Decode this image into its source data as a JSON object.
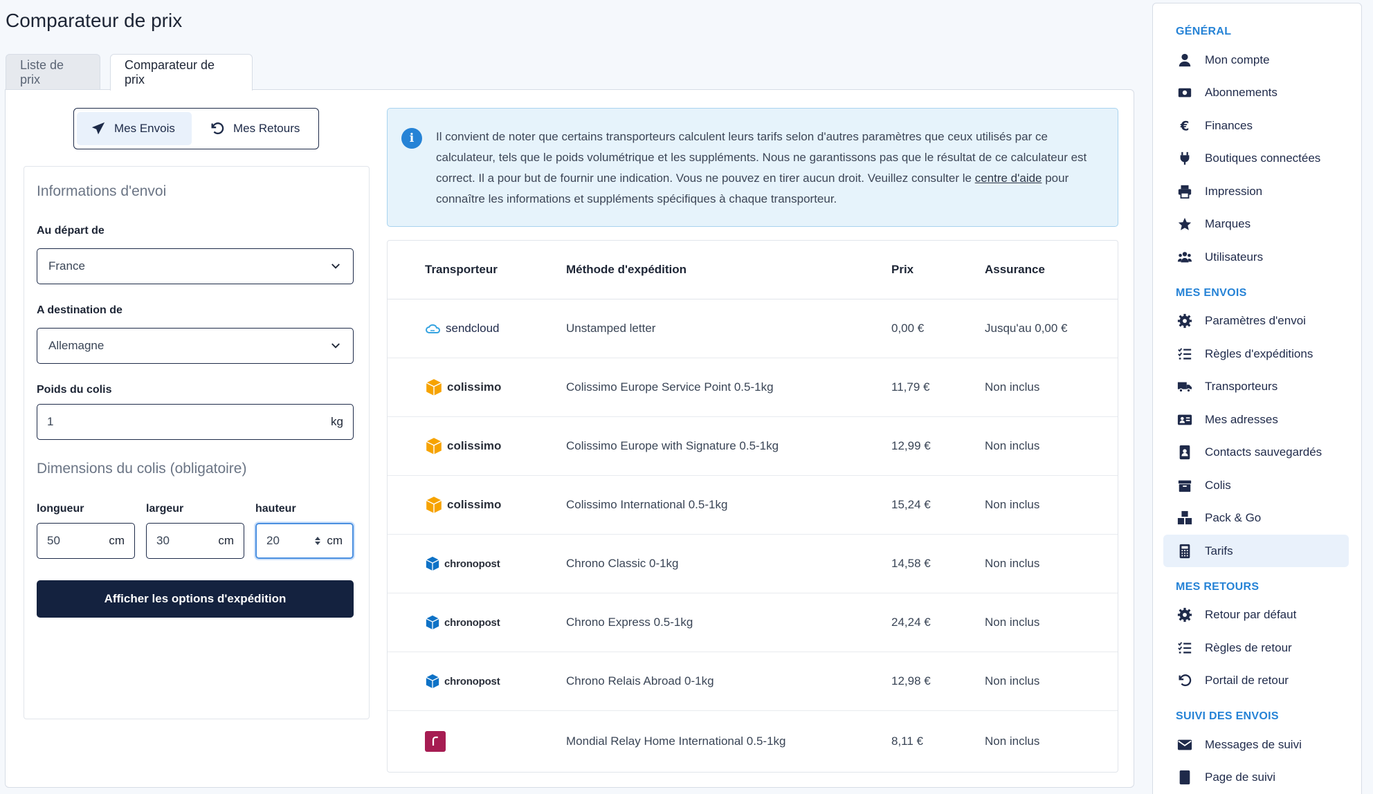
{
  "page": {
    "title": "Comparateur de prix"
  },
  "tabs": [
    {
      "label": "Liste de prix",
      "active": false
    },
    {
      "label": "Comparateur de prix",
      "active": true
    }
  ],
  "toggle": {
    "sends": "Mes Envois",
    "returns": "Mes Retours"
  },
  "form": {
    "section_shipping": "Informations d'envoi",
    "from_label": "Au départ de",
    "from_value": "France",
    "to_label": "A destination de",
    "to_value": "Allemagne",
    "weight_label": "Poids du colis",
    "weight_value": "1",
    "weight_unit": "kg",
    "section_dimensions": "Dimensions du colis (obligatoire)",
    "length_label": "longueur",
    "length_value": "50",
    "width_label": "largeur",
    "width_value": "30",
    "height_label": "hauteur",
    "height_value": "20",
    "dim_unit": "cm",
    "submit": "Afficher les options d'expédition"
  },
  "info": {
    "text_before": "Il convient de noter que certains transporteurs calculent leurs tarifs selon d'autres paramètres que ceux utilisés par ce calculateur, tels que le poids volumétrique et les suppléments. Nous ne garantissons pas que le résultat de ce calculateur est correct. Il a pour but de fournir une indication. Vous ne pouvez en tirer aucun droit. Veuillez consulter le ",
    "link": "centre d'aide",
    "text_after": " pour connaître les informations et suppléments spécifiques à chaque transporteur."
  },
  "table": {
    "headers": [
      "Transporteur",
      "Méthode d'expédition",
      "Prix",
      "Assurance"
    ],
    "rows": [
      {
        "carrier": "sendcloud",
        "logo": "sendcloud-logo",
        "method": "Unstamped letter",
        "price": "0,00 €",
        "insurance": "Jusqu'au 0,00 €"
      },
      {
        "carrier": "colissimo",
        "logo": "colissimo-logo",
        "method": "Colissimo Europe Service Point 0.5-1kg",
        "price": "11,79 €",
        "insurance": "Non inclus"
      },
      {
        "carrier": "colissimo",
        "logo": "colissimo-logo",
        "method": "Colissimo Europe with Signature 0.5-1kg",
        "price": "12,99 €",
        "insurance": "Non inclus"
      },
      {
        "carrier": "colissimo",
        "logo": "colissimo-logo",
        "method": "Colissimo International 0.5-1kg",
        "price": "15,24 €",
        "insurance": "Non inclus"
      },
      {
        "carrier": "chronopost",
        "logo": "chronopost-logo",
        "method": "Chrono Classic 0-1kg",
        "price": "14,58 €",
        "insurance": "Non inclus"
      },
      {
        "carrier": "chronopost",
        "logo": "chronopost-logo",
        "method": "Chrono Express 0.5-1kg",
        "price": "24,24 €",
        "insurance": "Non inclus"
      },
      {
        "carrier": "chronopost",
        "logo": "chronopost-logo",
        "method": "Chrono Relais Abroad 0-1kg",
        "price": "12,98 €",
        "insurance": "Non inclus"
      },
      {
        "carrier": "",
        "logo": "mondial-relay-logo",
        "method": "Mondial Relay Home International 0.5-1kg",
        "price": "8,11 €",
        "insurance": "Non inclus"
      }
    ]
  },
  "sidebar": {
    "sections": [
      {
        "title": "GÉNÉRAL",
        "items": [
          {
            "label": "Mon compte",
            "icon": "user-icon"
          },
          {
            "label": "Abonnements",
            "icon": "money-icon"
          },
          {
            "label": "Finances",
            "icon": "euro-icon"
          },
          {
            "label": "Boutiques connectées",
            "icon": "plug-icon"
          },
          {
            "label": "Impression",
            "icon": "printer-icon"
          },
          {
            "label": "Marques",
            "icon": "star-icon"
          },
          {
            "label": "Utilisateurs",
            "icon": "users-icon"
          }
        ]
      },
      {
        "title": "MES ENVOIS",
        "items": [
          {
            "label": "Paramètres d'envoi",
            "icon": "gear-icon"
          },
          {
            "label": "Règles d'expéditions",
            "icon": "list-check-icon"
          },
          {
            "label": "Transporteurs",
            "icon": "truck-icon"
          },
          {
            "label": "Mes adresses",
            "icon": "address-card-icon"
          },
          {
            "label": "Contacts sauvegardés",
            "icon": "contact-book-icon"
          },
          {
            "label": "Colis",
            "icon": "box-icon"
          },
          {
            "label": "Pack & Go",
            "icon": "boxes-icon"
          },
          {
            "label": "Tarifs",
            "icon": "calculator-icon",
            "active": true
          }
        ]
      },
      {
        "title": "MES RETOURS",
        "items": [
          {
            "label": "Retour par défaut",
            "icon": "gear-icon"
          },
          {
            "label": "Règles de retour",
            "icon": "list-check-icon"
          },
          {
            "label": "Portail de retour",
            "icon": "undo-icon"
          }
        ]
      },
      {
        "title": "SUIVI DES ENVOIS",
        "items": [
          {
            "label": "Messages de suivi",
            "icon": "envelope-icon"
          },
          {
            "label": "Page de suivi",
            "icon": "page-icon"
          }
        ]
      }
    ]
  },
  "colors": {
    "primary": "#14223f",
    "accent": "#2683d6",
    "info_bg": "#e6f3fb",
    "active_bg": "#e9f1fb"
  }
}
